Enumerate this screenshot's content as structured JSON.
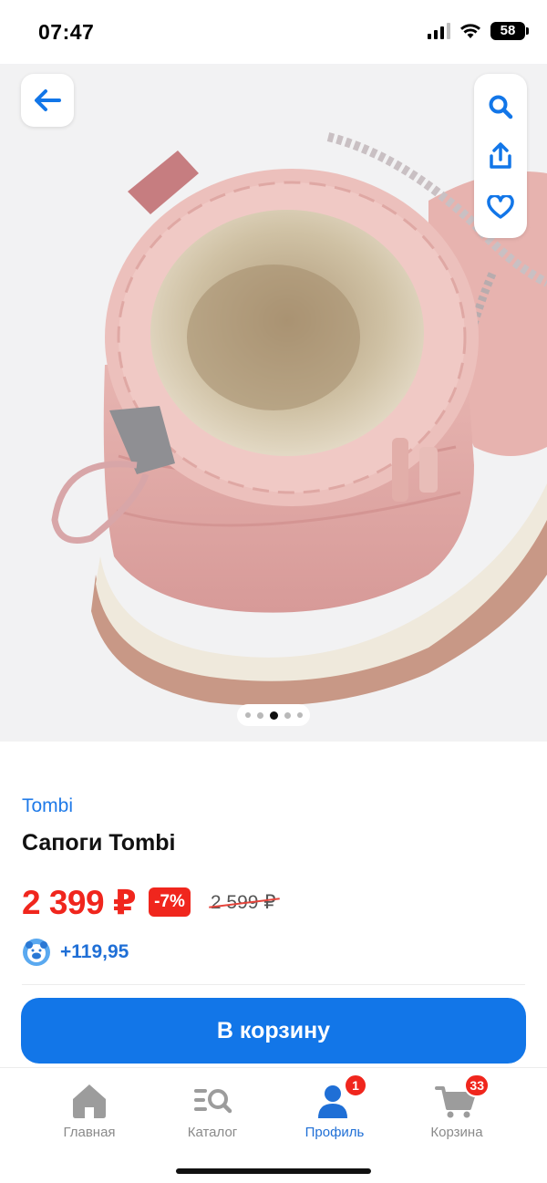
{
  "status": {
    "time": "07:47",
    "battery": "58"
  },
  "product": {
    "brand": "Tombi",
    "title": "Сапоги Tombi",
    "price": "2 399 ₽",
    "discount": "-7%",
    "old_price": "2 599 ₽",
    "bonus": "+119,95"
  },
  "gallery": {
    "page_count": 5,
    "active_page": 3
  },
  "actions": {
    "add_to_cart": "В корзину"
  },
  "tabbar": {
    "items": [
      {
        "label": "Главная",
        "icon": "home-icon",
        "badge": ""
      },
      {
        "label": "Каталог",
        "icon": "catalog-search-icon",
        "badge": ""
      },
      {
        "label": "Профиль",
        "icon": "profile-icon",
        "badge": "1"
      },
      {
        "label": "Корзина",
        "icon": "cart-icon",
        "badge": "33"
      }
    ]
  },
  "colors": {
    "accent": "#1276e8",
    "price": "#f0261d",
    "link": "#1f7ae8"
  }
}
